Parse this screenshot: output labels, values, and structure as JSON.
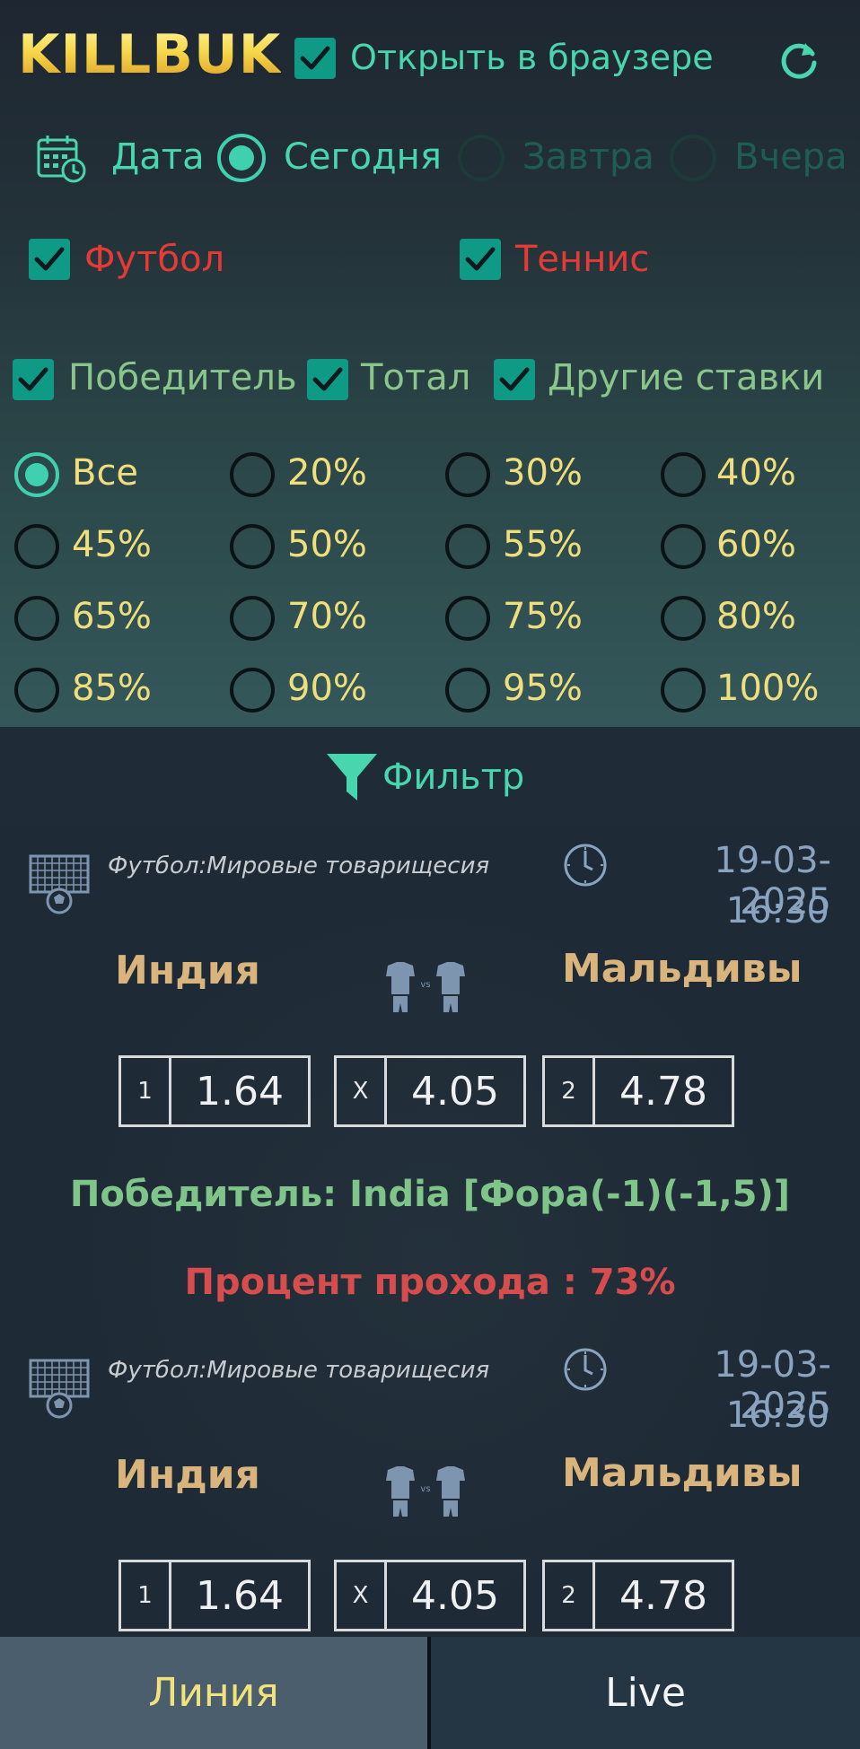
{
  "header": {
    "logo_text": "KILLBUK",
    "open_in_browser_label": "Открыть в браузере",
    "open_in_browser_checked": true,
    "refresh_icon": "refresh-icon"
  },
  "date": {
    "label": "Дата",
    "icon": "calendar-clock-icon",
    "options": [
      {
        "label": "Сегодня",
        "selected": true
      },
      {
        "label": "Завтра",
        "selected": false
      },
      {
        "label": "Вчера",
        "selected": false
      }
    ]
  },
  "sports": [
    {
      "label": "Футбол",
      "checked": true
    },
    {
      "label": "Теннис",
      "checked": true
    }
  ],
  "bet_types": [
    {
      "label": "Победитель",
      "checked": true
    },
    {
      "label": "Тотал",
      "checked": true
    },
    {
      "label": "Другие ставки",
      "checked": true
    }
  ],
  "percent_filter": {
    "options": [
      "Все",
      "20%",
      "30%",
      "40%",
      "45%",
      "50%",
      "55%",
      "60%",
      "65%",
      "70%",
      "75%",
      "80%",
      "85%",
      "90%",
      "95%",
      "100%"
    ],
    "selected": "Все"
  },
  "filter_button": {
    "label": "Фильтр",
    "icon": "funnel-icon"
  },
  "matches": [
    {
      "league": "Футбол:Мировые товарищесия",
      "date": "19-03-2025",
      "time": "16:30",
      "home": "Индия",
      "away": "Мальдивы",
      "odds": [
        {
          "key": "1",
          "value": "1.64"
        },
        {
          "key": "X",
          "value": "4.05"
        },
        {
          "key": "2",
          "value": "4.78"
        }
      ],
      "winner": "Победитель: India [Фора(-1)(-1,5)]",
      "percent": "Процент прохода : 73%"
    },
    {
      "league": "Футбол:Мировые товарищесия",
      "date": "19-03-2025",
      "time": "16:30",
      "home": "Индия",
      "away": "Мальдивы",
      "odds": [
        {
          "key": "1",
          "value": "1.64"
        },
        {
          "key": "X",
          "value": "4.05"
        },
        {
          "key": "2",
          "value": "4.78"
        }
      ]
    }
  ],
  "tabs": [
    {
      "label": "Линия",
      "active": true
    },
    {
      "label": "Live",
      "active": false
    }
  ],
  "colors": {
    "accent_teal": "#47d6ad",
    "checkbox_bg": "#0e9a84",
    "sport_red": "#e53a35",
    "percent_yellow": "#f0de7c",
    "team_gold": "#d9b47c"
  }
}
